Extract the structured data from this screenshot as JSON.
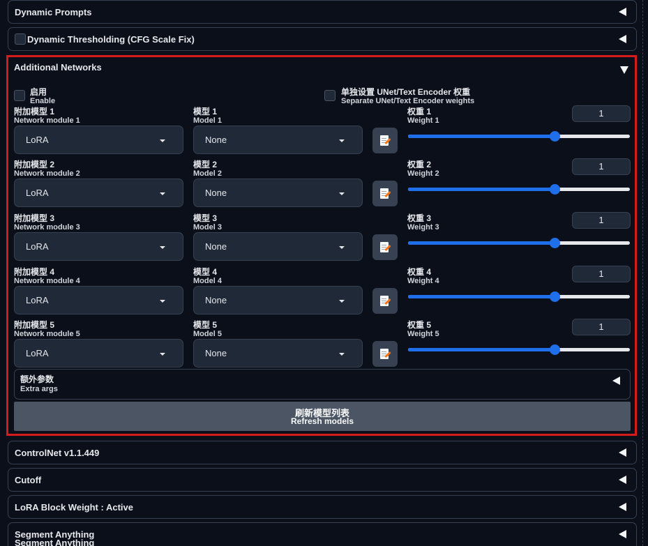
{
  "accordions_top": [
    {
      "title": "Dynamic Prompts"
    },
    {
      "title": "Dynamic Thresholding (CFG Scale Fix)"
    }
  ],
  "additional_networks": {
    "title": "Additional Networks",
    "enable_cn": "启用",
    "enable_en": "Enable",
    "separate_cn": "单独设置 UNet/Text Encoder 权重",
    "separate_en": "Separate UNet/Text Encoder weights",
    "rows": [
      {
        "module_cn": "附加模型 1",
        "module_en": "Network module 1",
        "module_value": "LoRA",
        "model_cn": "模型 1",
        "model_en": "Model 1",
        "model_value": "None",
        "weight_cn": "权重 1",
        "weight_en": "Weight 1",
        "weight_value": "1",
        "slider_fraction": 0.66
      },
      {
        "module_cn": "附加模型 2",
        "module_en": "Network module 2",
        "module_value": "LoRA",
        "model_cn": "模型 2",
        "model_en": "Model 2",
        "model_value": "None",
        "weight_cn": "权重 2",
        "weight_en": "Weight 2",
        "weight_value": "1",
        "slider_fraction": 0.66
      },
      {
        "module_cn": "附加模型 3",
        "module_en": "Network module 3",
        "module_value": "LoRA",
        "model_cn": "模型 3",
        "model_en": "Model 3",
        "model_value": "None",
        "weight_cn": "权重 3",
        "weight_en": "Weight 3",
        "weight_value": "1",
        "slider_fraction": 0.66
      },
      {
        "module_cn": "附加模型 4",
        "module_en": "Network module 4",
        "module_value": "LoRA",
        "model_cn": "模型 4",
        "model_en": "Model 4",
        "model_value": "None",
        "weight_cn": "权重 4",
        "weight_en": "Weight 4",
        "weight_value": "1",
        "slider_fraction": 0.66
      },
      {
        "module_cn": "附加模型 5",
        "module_en": "Network module 5",
        "module_value": "LoRA",
        "model_cn": "模型 5",
        "model_en": "Model 5",
        "model_value": "None",
        "weight_cn": "权重 5",
        "weight_en": "Weight 5",
        "weight_value": "1",
        "slider_fraction": 0.66
      }
    ],
    "extra_args_cn": "额外参数",
    "extra_args_en": "Extra args",
    "refresh_cn": "刷新模型列表",
    "refresh_en": "Refresh models"
  },
  "accordions_bottom": [
    {
      "title": "ControlNet v1.1.449"
    },
    {
      "title": "Cutoff"
    },
    {
      "title": "LoRA Block Weight : Active"
    },
    {
      "title": "Segment Anything",
      "subtitle": "Segment Anything"
    }
  ],
  "colors": {
    "highlight_border": "#d41c1c",
    "slider_accent": "#1f6feb",
    "background": "#0b0f19"
  }
}
